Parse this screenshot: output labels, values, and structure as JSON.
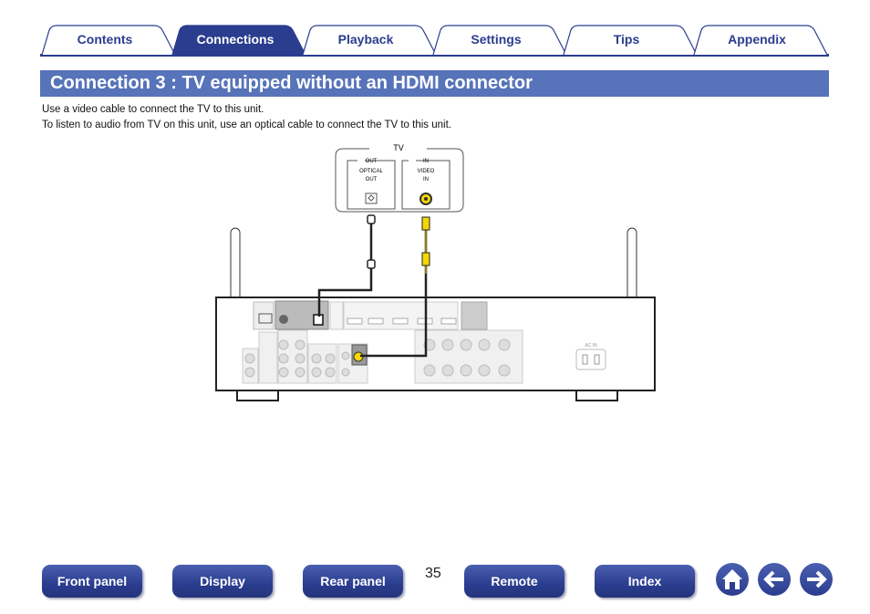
{
  "tabs": [
    {
      "label": "Contents",
      "active": false
    },
    {
      "label": "Connections",
      "active": true
    },
    {
      "label": "Playback",
      "active": false
    },
    {
      "label": "Settings",
      "active": false
    },
    {
      "label": "Tips",
      "active": false
    },
    {
      "label": "Appendix",
      "active": false
    }
  ],
  "title": "Connection 3 : TV equipped without an HDMI connector",
  "paragraphs": [
    "Use a video cable to connect the TV to this unit.",
    "To listen to audio from TV on this unit, use an optical cable to connect the TV to this unit."
  ],
  "diagram": {
    "tv_label": "TV",
    "out_label": "OUT",
    "optical_out_1": "OPTICAL",
    "optical_out_2": "OUT",
    "in_label": "IN",
    "video_in_1": "VIDEO",
    "video_in_2": "IN",
    "ac_in": "AC IN",
    "cable_colors": {
      "optical": "#222222",
      "video": "#f5d800"
    }
  },
  "footer": {
    "buttons": [
      "Front panel",
      "Display",
      "Rear panel",
      "Remote",
      "Index"
    ],
    "page_number": "35",
    "icons": [
      "home-icon",
      "arrow-left-icon",
      "arrow-right-icon"
    ]
  },
  "colors": {
    "accent": "#2b3d8f",
    "title_bg": "#5773b9"
  }
}
